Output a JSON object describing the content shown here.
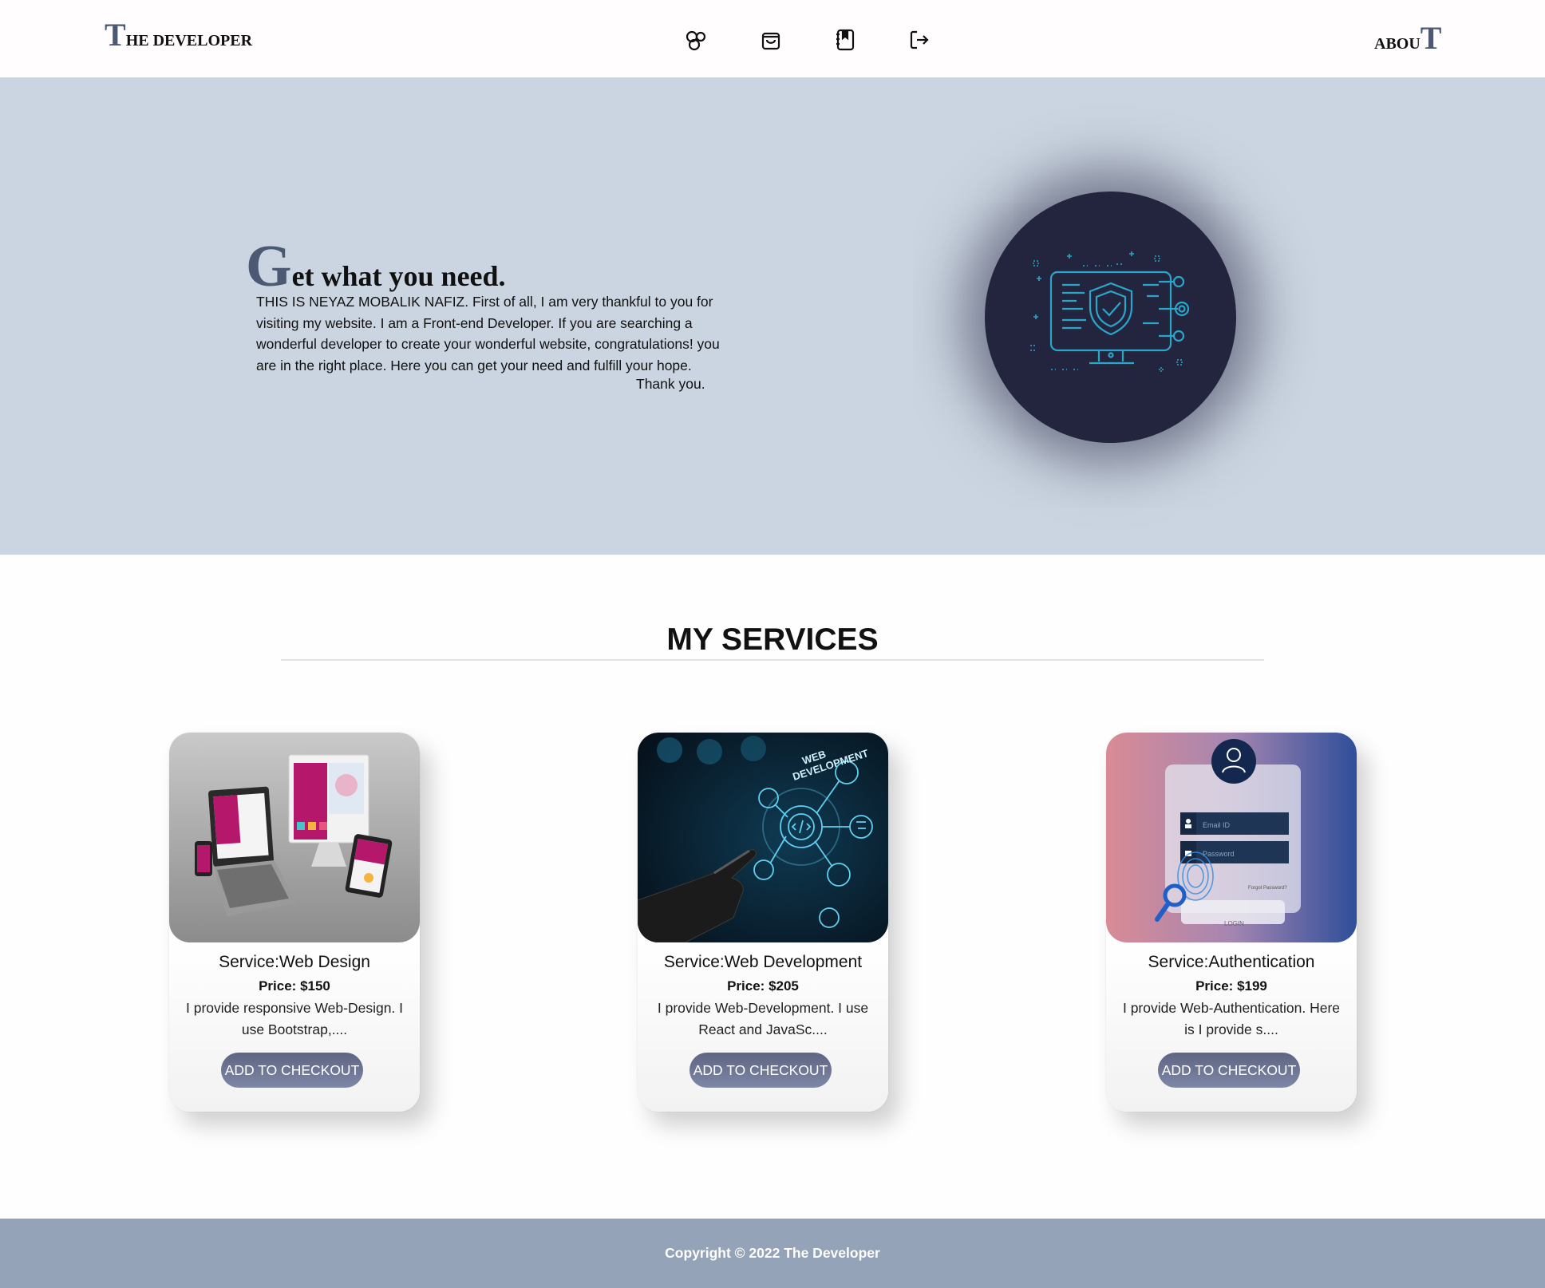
{
  "nav": {
    "brand_cap": "T",
    "brand_rest": "HE DEVELOPER",
    "icons": [
      "services-icon",
      "cart-icon",
      "bookmark-icon",
      "logout-icon"
    ],
    "about_rest": "ABOU",
    "about_cap": "T"
  },
  "hero": {
    "title_cap": "G",
    "title_rest": "et what you need.",
    "text": "THIS IS NEYAZ MOBALIK NAFIZ. First of all, I am very thankful to you for visiting my website. I am a Front-end Developer. If you are searching a wonderful developer to create your wonderful website, congratulations! you are in the right place. Here you can get your need and fulfill your hope.",
    "thanks": "Thank you.",
    "illustration": "security-monitor-icon"
  },
  "services": {
    "title": "MY SERVICES",
    "cards": [
      {
        "name": "Service:Web Design",
        "price": "Price: $150",
        "desc": "I provide responsive Web-Design. I use Bootstrap,....",
        "button": "ADD TO CHECKOUT"
      },
      {
        "name": "Service:Web Development",
        "price": "Price: $205",
        "desc": "I provide Web-Development. I use React and JavaSc....",
        "button": "ADD TO CHECKOUT"
      },
      {
        "name": "Service:Authentication",
        "price": "Price: $199",
        "desc": "I provide Web-Authentication. Here is I provide s....",
        "button": "ADD TO CHECKOUT"
      }
    ],
    "auth_form": {
      "email_placeholder": "Email ID",
      "password_placeholder": "Password",
      "forgot": "Forgot Password?",
      "login": "LOGIN"
    },
    "webdev_label_1": "WEB",
    "webdev_label_2": "DEVELOPMENT"
  },
  "footer": {
    "text": "Copyright © 2022 The Developer"
  },
  "colors": {
    "hero_bg": "#cbd5e1",
    "accent": "#4b5a72",
    "footer_bg": "#94a3b8",
    "button": "#6b7392"
  }
}
